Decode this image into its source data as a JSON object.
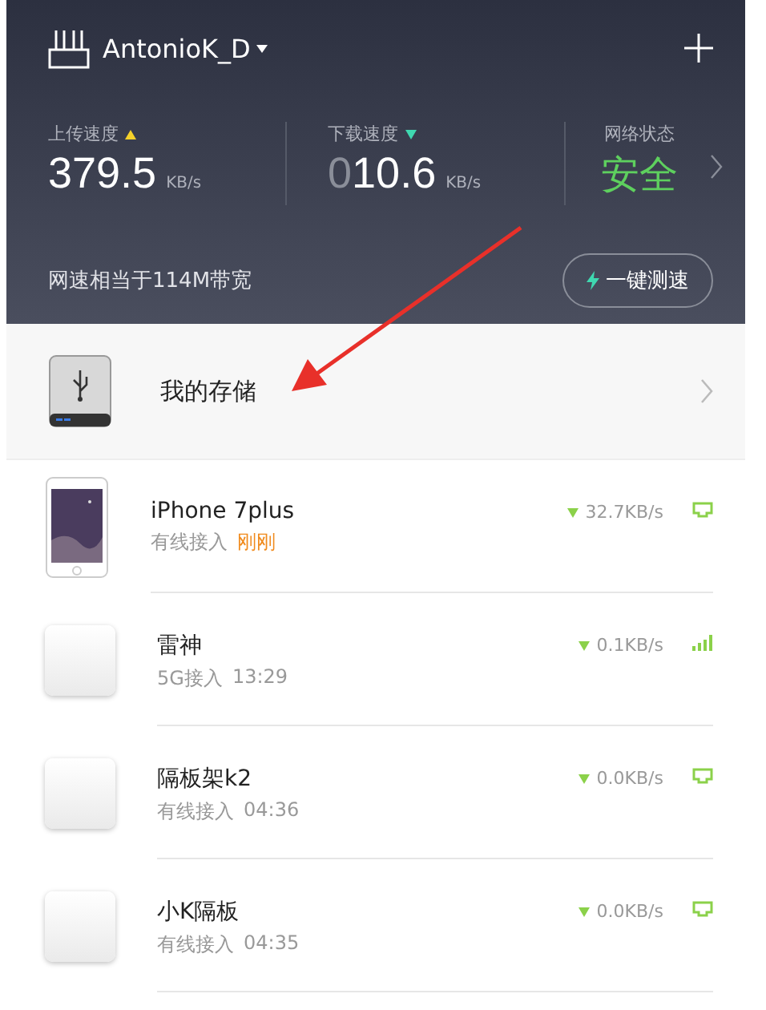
{
  "header": {
    "router_name": "AntonioK_D",
    "stats": [
      {
        "label": "上传速度",
        "kind": "upload",
        "value": "379.5",
        "unit": "KB/s"
      },
      {
        "label": "下载速度",
        "kind": "download",
        "value_dim": "0",
        "value": "10.6",
        "unit": "KB/s"
      }
    ],
    "status": {
      "label": "网络状态",
      "value": "安全"
    },
    "bandwidth": "网速相当于114M带宽",
    "speed_test": "一键测速"
  },
  "storage": {
    "label": "我的存储"
  },
  "devices": [
    {
      "name": "iPhone 7plus",
      "kind": "picture",
      "connection": "有线接入",
      "time": "刚刚",
      "recent": true,
      "speed": "32.7KB/s",
      "wired": true
    },
    {
      "name": "雷神",
      "kind": "tile",
      "connection": "5G接入",
      "time": "13:29",
      "recent": false,
      "speed": "0.1KB/s",
      "wired": false
    },
    {
      "name": "隔板架k2",
      "kind": "tile",
      "connection": "有线接入",
      "time": "04:36",
      "recent": false,
      "speed": "0.0KB/s",
      "wired": true
    },
    {
      "name": "小K隔板",
      "kind": "tile",
      "connection": "有线接入",
      "time": "04:35",
      "recent": false,
      "speed": "0.0KB/s",
      "wired": true
    }
  ]
}
